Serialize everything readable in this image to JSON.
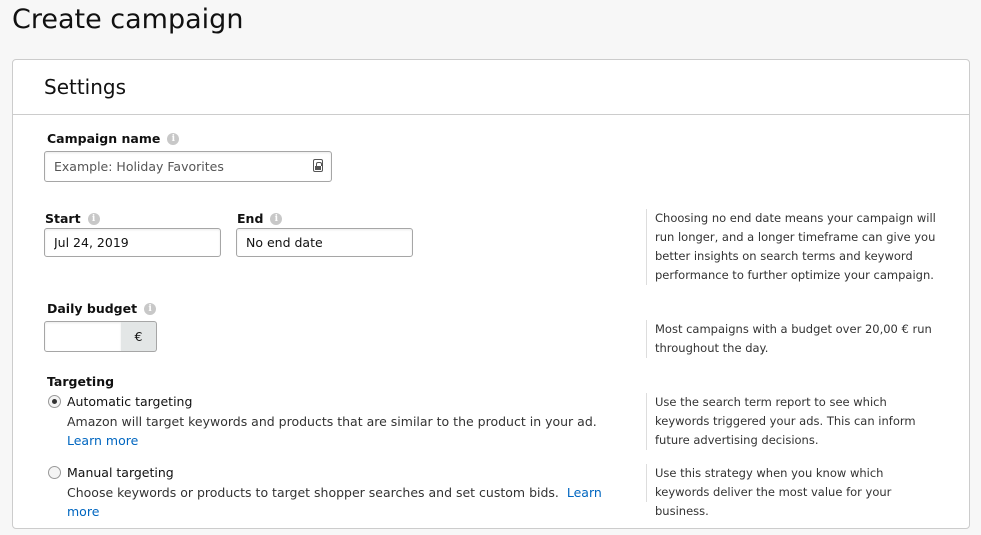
{
  "page": {
    "title": "Create campaign"
  },
  "settings": {
    "title": "Settings",
    "campaign_name": {
      "label": "Campaign name",
      "value": "",
      "placeholder": "Example: Holiday Favorites"
    },
    "start": {
      "label": "Start",
      "value": "Jul 24, 2019"
    },
    "end": {
      "label": "End",
      "value": "No end date"
    },
    "end_help": "Choosing no end date means your campaign will run longer, and a longer timeframe can give you better insights on search terms and keyword performance to further optimize your campaign.",
    "daily_budget": {
      "label": "Daily budget",
      "value": "",
      "currency": "€"
    },
    "budget_help": "Most campaigns with a budget over 20,00 € run throughout the day.",
    "targeting": {
      "label": "Targeting",
      "automatic": {
        "title": "Automatic targeting",
        "description": "Amazon will target keywords and products that are similar to the product in your ad.",
        "link": "Learn more",
        "help": "Use the search term report to see which keywords triggered your ads. This can inform future advertising decisions.",
        "selected": true
      },
      "manual": {
        "title": "Manual targeting",
        "description": "Choose keywords or products to target shopper searches and set custom bids.",
        "link": "Learn more",
        "help": "Use this strategy when you know which keywords deliver the most value for your business.",
        "selected": false
      }
    }
  },
  "icons": {
    "info": "info-icon",
    "contact_card": "contact-card-icon"
  }
}
